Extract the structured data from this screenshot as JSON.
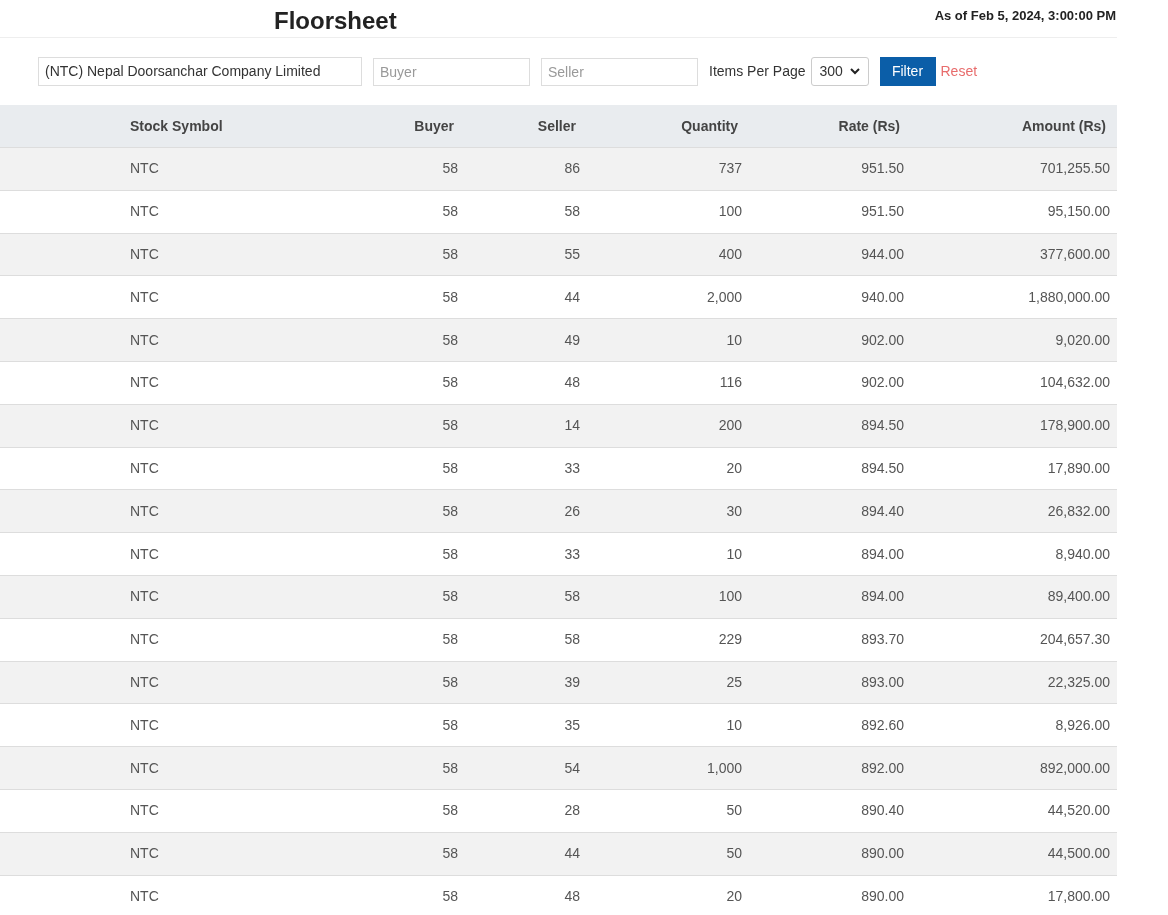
{
  "title": "Floorsheet",
  "as_of": "As of Feb 5, 2024, 3:00:00 PM",
  "filters": {
    "company": "(NTC) Nepal Doorsanchar Company Limited",
    "buyer_placeholder": "Buyer",
    "seller_placeholder": "Seller",
    "items_label": "Items Per Page",
    "items_per_page": "300",
    "filter_button": "Filter",
    "reset_link": "Reset"
  },
  "table": {
    "columns": [
      "Stock Symbol",
      "Buyer",
      "Seller",
      "Quantity",
      "Rate (Rs)",
      "Amount (Rs)"
    ],
    "rows": [
      [
        "NTC",
        "58",
        "86",
        "737",
        "951.50",
        "701,255.50"
      ],
      [
        "NTC",
        "58",
        "58",
        "100",
        "951.50",
        "95,150.00"
      ],
      [
        "NTC",
        "58",
        "55",
        "400",
        "944.00",
        "377,600.00"
      ],
      [
        "NTC",
        "58",
        "44",
        "2,000",
        "940.00",
        "1,880,000.00"
      ],
      [
        "NTC",
        "58",
        "49",
        "10",
        "902.00",
        "9,020.00"
      ],
      [
        "NTC",
        "58",
        "48",
        "116",
        "902.00",
        "104,632.00"
      ],
      [
        "NTC",
        "58",
        "14",
        "200",
        "894.50",
        "178,900.00"
      ],
      [
        "NTC",
        "58",
        "33",
        "20",
        "894.50",
        "17,890.00"
      ],
      [
        "NTC",
        "58",
        "26",
        "30",
        "894.40",
        "26,832.00"
      ],
      [
        "NTC",
        "58",
        "33",
        "10",
        "894.00",
        "8,940.00"
      ],
      [
        "NTC",
        "58",
        "58",
        "100",
        "894.00",
        "89,400.00"
      ],
      [
        "NTC",
        "58",
        "58",
        "229",
        "893.70",
        "204,657.30"
      ],
      [
        "NTC",
        "58",
        "39",
        "25",
        "893.00",
        "22,325.00"
      ],
      [
        "NTC",
        "58",
        "35",
        "10",
        "892.60",
        "8,926.00"
      ],
      [
        "NTC",
        "58",
        "54",
        "1,000",
        "892.00",
        "892,000.00"
      ],
      [
        "NTC",
        "58",
        "28",
        "50",
        "890.40",
        "44,520.00"
      ],
      [
        "NTC",
        "58",
        "44",
        "50",
        "890.00",
        "44,500.00"
      ],
      [
        "NTC",
        "58",
        "48",
        "20",
        "890.00",
        "17,800.00"
      ]
    ]
  }
}
